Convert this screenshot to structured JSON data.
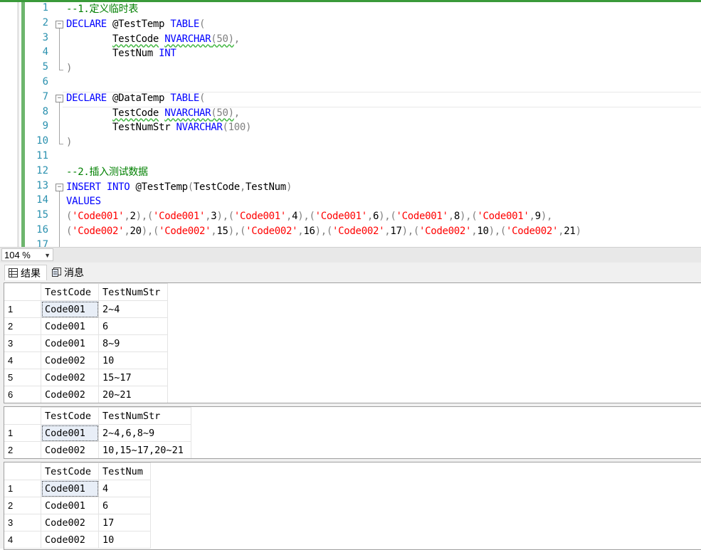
{
  "editor": {
    "line_numbers": [
      "1",
      "2",
      "3",
      "4",
      "5",
      "6",
      "7",
      "8",
      "9",
      "10",
      "11",
      "12",
      "13",
      "14",
      "15",
      "16",
      "17"
    ],
    "lines": [
      [
        {
          "t": "--1.定义临时表",
          "c": "cm"
        }
      ],
      [
        {
          "t": "DECLARE ",
          "c": "kw"
        },
        {
          "t": "@TestTemp ",
          "c": "tx"
        },
        {
          "t": "TABLE",
          "c": "kw"
        },
        {
          "t": "(",
          "c": "gr"
        }
      ],
      [
        {
          "t": "        ",
          "c": "tx"
        },
        {
          "t": "TestCode",
          "c": "tx sq"
        },
        {
          "t": " ",
          "c": "tx"
        },
        {
          "t": "NVARCHAR",
          "c": "kw sq"
        },
        {
          "t": "(50)",
          "c": "gr sq"
        },
        {
          "t": ",",
          "c": "gr"
        }
      ],
      [
        {
          "t": "        TestNum ",
          "c": "tx"
        },
        {
          "t": "INT",
          "c": "kw"
        }
      ],
      [
        {
          "t": ")",
          "c": "gr"
        }
      ],
      [
        {
          "t": "",
          "c": "tx"
        }
      ],
      [
        {
          "t": "DECLARE ",
          "c": "kw"
        },
        {
          "t": "@DataTemp ",
          "c": "tx"
        },
        {
          "t": "TABLE",
          "c": "kw"
        },
        {
          "t": "(",
          "c": "gr"
        }
      ],
      [
        {
          "t": "        ",
          "c": "tx"
        },
        {
          "t": "TestCode",
          "c": "tx sq"
        },
        {
          "t": " ",
          "c": "tx"
        },
        {
          "t": "NVARCHAR",
          "c": "kw sq"
        },
        {
          "t": "(50)",
          "c": "gr sq"
        },
        {
          "t": ",",
          "c": "gr"
        }
      ],
      [
        {
          "t": "        TestNumStr ",
          "c": "tx"
        },
        {
          "t": "NVARCHAR",
          "c": "kw"
        },
        {
          "t": "(100)",
          "c": "gr"
        }
      ],
      [
        {
          "t": ")",
          "c": "gr"
        }
      ],
      [
        {
          "t": "",
          "c": "tx"
        }
      ],
      [
        {
          "t": "--2.插入测试数据",
          "c": "cm"
        }
      ],
      [
        {
          "t": "INSERT INTO ",
          "c": "kw"
        },
        {
          "t": "@TestTemp",
          "c": "tx"
        },
        {
          "t": "(",
          "c": "gr"
        },
        {
          "t": "TestCode",
          "c": "tx"
        },
        {
          "t": ",",
          "c": "gr"
        },
        {
          "t": "TestNum",
          "c": "tx"
        },
        {
          "t": ")",
          "c": "gr"
        }
      ],
      [
        {
          "t": "VALUES",
          "c": "kw"
        }
      ],
      [
        {
          "t": "(",
          "c": "gr"
        },
        {
          "t": "'Code001'",
          "c": "st"
        },
        {
          "t": ",",
          "c": "gr"
        },
        {
          "t": "2",
          "c": "tx"
        },
        {
          "t": "),(",
          "c": "gr"
        },
        {
          "t": "'Code001'",
          "c": "st"
        },
        {
          "t": ",",
          "c": "gr"
        },
        {
          "t": "3",
          "c": "tx"
        },
        {
          "t": "),(",
          "c": "gr"
        },
        {
          "t": "'Code001'",
          "c": "st"
        },
        {
          "t": ",",
          "c": "gr"
        },
        {
          "t": "4",
          "c": "tx"
        },
        {
          "t": "),(",
          "c": "gr"
        },
        {
          "t": "'Code001'",
          "c": "st"
        },
        {
          "t": ",",
          "c": "gr"
        },
        {
          "t": "6",
          "c": "tx"
        },
        {
          "t": "),(",
          "c": "gr"
        },
        {
          "t": "'Code001'",
          "c": "st"
        },
        {
          "t": ",",
          "c": "gr"
        },
        {
          "t": "8",
          "c": "tx"
        },
        {
          "t": "),(",
          "c": "gr"
        },
        {
          "t": "'Code001'",
          "c": "st"
        },
        {
          "t": ",",
          "c": "gr"
        },
        {
          "t": "9",
          "c": "tx"
        },
        {
          "t": "),",
          "c": "gr"
        }
      ],
      [
        {
          "t": "(",
          "c": "gr"
        },
        {
          "t": "'Code002'",
          "c": "st"
        },
        {
          "t": ",",
          "c": "gr"
        },
        {
          "t": "20",
          "c": "tx"
        },
        {
          "t": "),(",
          "c": "gr"
        },
        {
          "t": "'Code002'",
          "c": "st"
        },
        {
          "t": ",",
          "c": "gr"
        },
        {
          "t": "15",
          "c": "tx"
        },
        {
          "t": "),(",
          "c": "gr"
        },
        {
          "t": "'Code002'",
          "c": "st"
        },
        {
          "t": ",",
          "c": "gr"
        },
        {
          "t": "16",
          "c": "tx"
        },
        {
          "t": "),(",
          "c": "gr"
        },
        {
          "t": "'Code002'",
          "c": "st"
        },
        {
          "t": ",",
          "c": "gr"
        },
        {
          "t": "17",
          "c": "tx"
        },
        {
          "t": "),(",
          "c": "gr"
        },
        {
          "t": "'Code002'",
          "c": "st"
        },
        {
          "t": ",",
          "c": "gr"
        },
        {
          "t": "10",
          "c": "tx"
        },
        {
          "t": "),(",
          "c": "gr"
        },
        {
          "t": "'Code002'",
          "c": "st"
        },
        {
          "t": ",",
          "c": "gr"
        },
        {
          "t": "21",
          "c": "tx"
        },
        {
          "t": ")",
          "c": "gr"
        }
      ],
      [
        {
          "t": "",
          "c": "tx"
        }
      ]
    ],
    "fold_icon": "minus-box-icon"
  },
  "status": {
    "zoom": "104 %"
  },
  "tabs": [
    {
      "label": "结果",
      "icon": "grid-icon"
    },
    {
      "label": "消息",
      "icon": "message-icon"
    }
  ],
  "results": [
    {
      "columns": [
        "TestCode",
        "TestNumStr"
      ],
      "rows": [
        [
          "1",
          "Code001",
          "2~4"
        ],
        [
          "2",
          "Code001",
          "6"
        ],
        [
          "3",
          "Code001",
          "8~9"
        ],
        [
          "4",
          "Code002",
          "10"
        ],
        [
          "5",
          "Code002",
          "15~17"
        ],
        [
          "6",
          "Code002",
          "20~21"
        ]
      ]
    },
    {
      "columns": [
        "TestCode",
        "TestNumStr"
      ],
      "rows": [
        [
          "1",
          "Code001",
          "2~4,6,8~9"
        ],
        [
          "2",
          "Code002",
          "10,15~17,20~21"
        ]
      ]
    },
    {
      "columns": [
        "TestCode",
        "TestNum"
      ],
      "rows": [
        [
          "1",
          "Code001",
          "4"
        ],
        [
          "2",
          "Code001",
          "6"
        ],
        [
          "3",
          "Code002",
          "17"
        ],
        [
          "4",
          "Code002",
          "10"
        ]
      ]
    }
  ],
  "colors": {
    "keyword": "#0000ff",
    "comment": "#008000",
    "string": "#ff0000",
    "linenumber": "#2b91af"
  }
}
